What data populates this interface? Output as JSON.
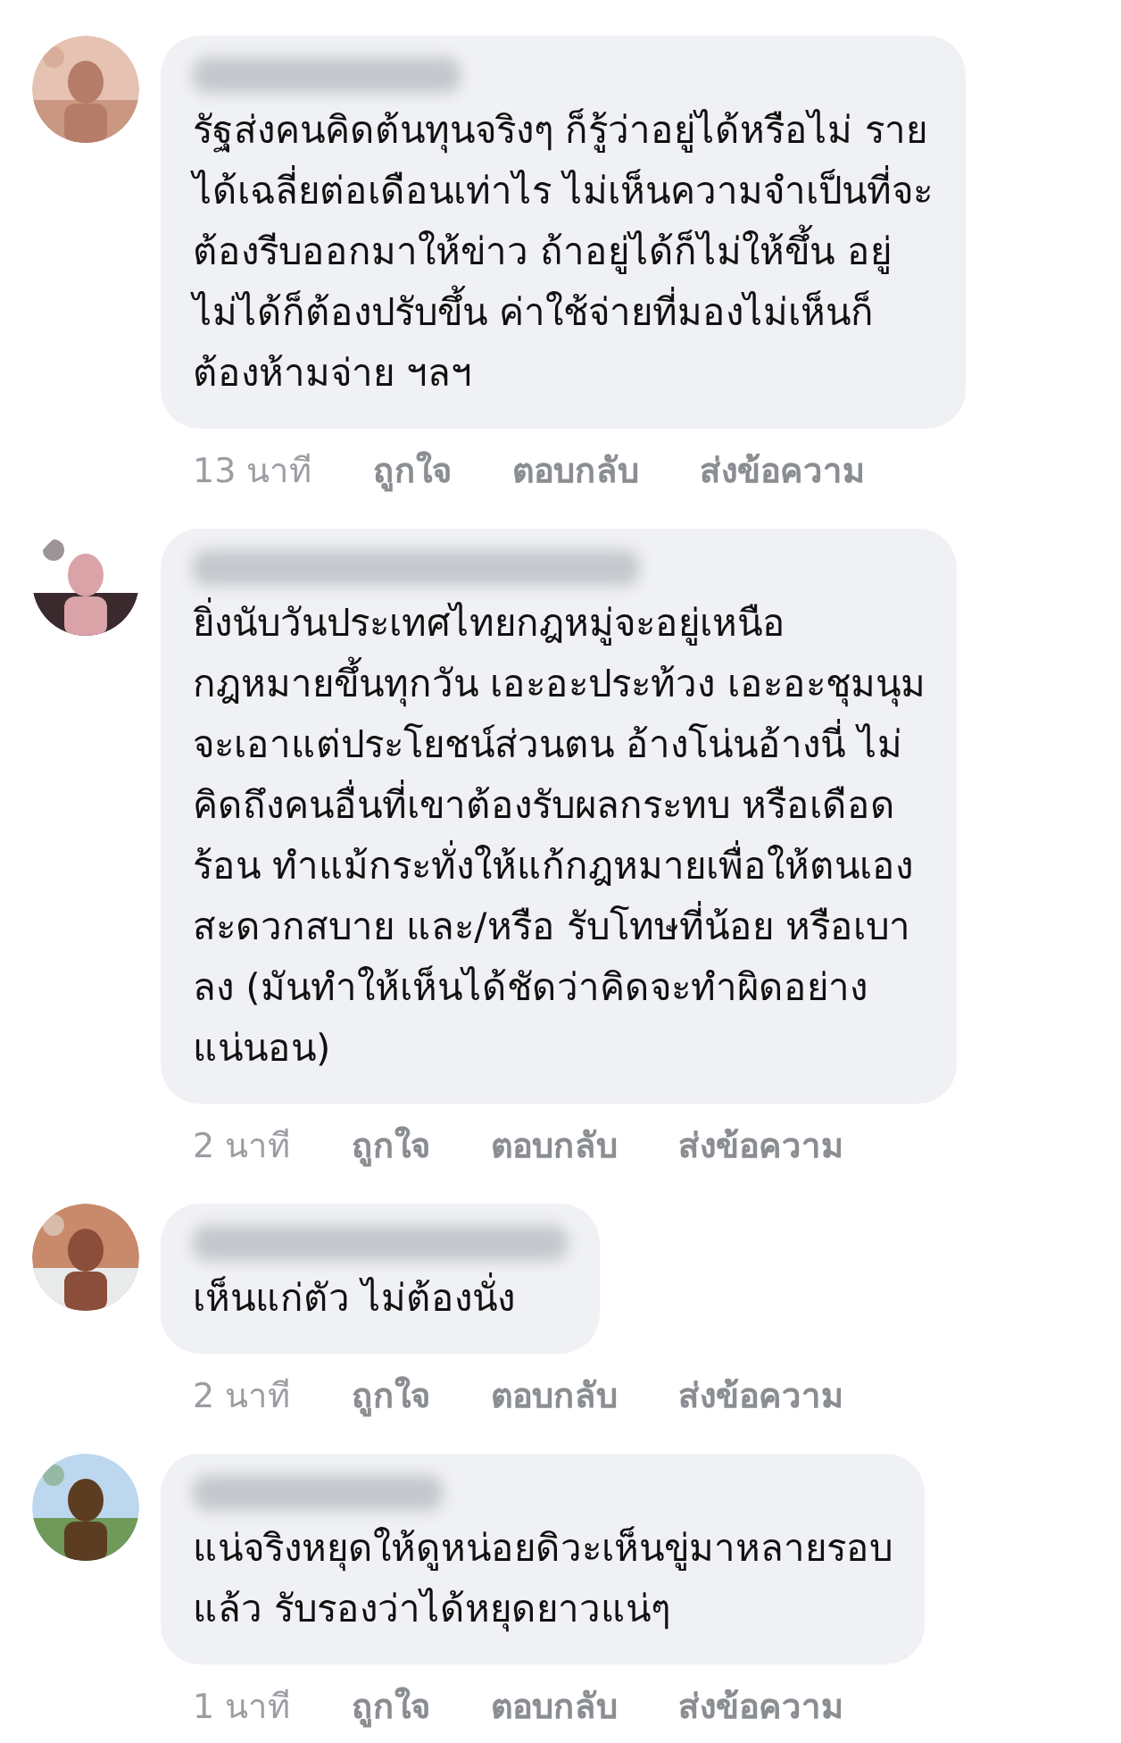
{
  "comments": [
    {
      "text_lines": [
        "รัฐส่งคนคิดต้นทุนจริงๆ ก็รู้ว่าอยู่ได้หรือไม่ ราย",
        "ได้เฉลี่ยต่อเดือนเท่าไร ไม่เห็นความจำเป็นที่จะ",
        "ต้องรีบออกมาให้ข่าว ถ้าอยู่ได้ก็ไม่ให้ขึ้น อยู่",
        "ไม่ได้ก็ต้องปรับขึ้น ค่าใช้จ่ายที่มองไม่เห็นก็",
        "ต้องห้ามจ่าย ฯลฯ"
      ],
      "time": "13 นาที",
      "actions": [
        "ถูกใจ",
        "ตอบกลับ",
        "ส่งข้อความ"
      ]
    },
    {
      "text_lines": [
        "ยิ่งนับวันประเทศไทยกฎหมู่จะอยู่เหนือ",
        "กฎหมายขึ้นทุกวัน เอะอะประท้วง เอะอะชุมนุม",
        "จะเอาแต่ประโยชน์ส่วนตน อ้างโน่นอ้างนี่ ไม่",
        "คิดถึงคนอื่นที่เขาต้องรับผลกระทบ หรือเดือด",
        "ร้อน ทำแม้กระทั่งให้แก้กฎหมายเพื่อให้ตนเอง",
        "สะดวกสบาย และ/หรือ รับโทษที่น้อย หรือเบา",
        "ลง (มันทำให้เห็นได้ชัดว่าคิดจะทำผิดอย่าง",
        "แน่นอน)"
      ],
      "time": "2 นาที",
      "actions": [
        "ถูกใจ",
        "ตอบกลับ",
        "ส่งข้อความ"
      ]
    },
    {
      "text_lines": [
        "เห็นแก่ตัว ไม่ต้องนั่ง"
      ],
      "time": "2 นาที",
      "actions": [
        "ถูกใจ",
        "ตอบกลับ",
        "ส่งข้อความ"
      ]
    },
    {
      "text_lines": [
        "แน่จริงหยุดให้ดูหน่อยดิวะเห็นขู่มาหลายรอบ",
        "แล้ว รับรองว่าได้หยุดยาวแน่ๆ"
      ],
      "time": "1 นาที",
      "actions": [
        "ถูกใจ",
        "ตอบกลับ",
        "ส่งข้อความ"
      ]
    }
  ]
}
